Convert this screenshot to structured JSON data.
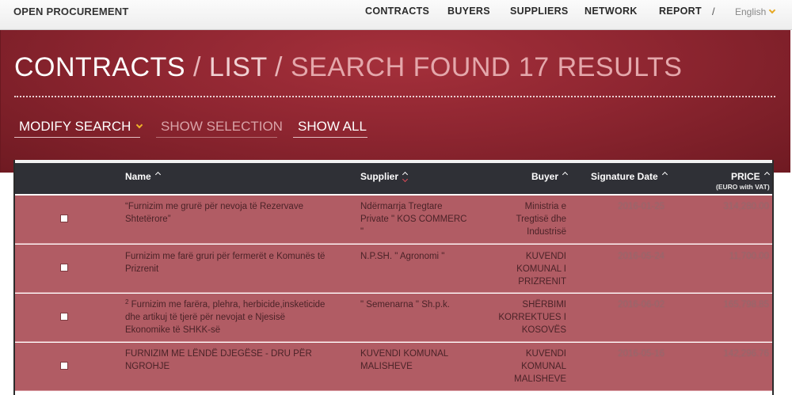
{
  "brand": "OPEN PROCUREMENT",
  "nav": {
    "items": [
      "CONTRACTS",
      "BUYERS",
      "SUPPLIERS",
      "NETWORK",
      "REPORT"
    ],
    "separator": "/",
    "language": "English"
  },
  "hero": {
    "title_main": "CONTRACTS",
    "title_sep": " / ",
    "title_list": "LIST",
    "title_sep2": " / ",
    "title_search": "SEARCH FOUND 17 RESULTS",
    "buttons": {
      "modify": "MODIFY SEARCH",
      "selection": "SHOW SELECTION",
      "all": "SHOW ALL"
    }
  },
  "table": {
    "columns": {
      "name": "Name",
      "supplier": "Supplier",
      "buyer": "Buyer",
      "date": "Signature Date",
      "price": "PRICE",
      "price_sub": "(EURO with VAT)"
    },
    "rows": [
      {
        "name_sup": "",
        "name": "“Furnizim me grurë për nevoja të Rezervave Shtetërore”",
        "supplier": "Ndërmarrja Tregtare Private \" KOS COMMERC \"",
        "buyer": "Ministria e Tregtisë dhe Industrisë",
        "date": "2016-01-25",
        "price": "314,280.00"
      },
      {
        "name_sup": "",
        "name": "Furnizim me farë gruri për fermerët e Komunës të Prizrenit",
        "supplier": "N.P.SH. \" Agronomi \"",
        "buyer": "KUVENDI KOMUNAL I PRIZRENIT",
        "date": "2016-05-24",
        "price": "11,700.00"
      },
      {
        "name_sup": "2",
        "name": " Furnizim me farëra, plehra, herbicide,insketicide dhe artikuj të tjerë për nevojat e Njesisë Ekonomike të SHKK-së",
        "supplier": "\" Semenarna \" Sh.p.k.",
        "buyer": "SHËRBIMI KORREKTUES I KOSOVËS",
        "date": "2016-06-02",
        "price": "165,798.85"
      },
      {
        "name_sup": "",
        "name": "FURNIZIM ME LËNDË DJEGËSE - DRU PËR NGROHJE",
        "supplier": "KUVENDI KOMUNAL MALISHEVE",
        "buyer": "KUVENDI KOMUNAL MALISHEVE",
        "date": "2016-05-16",
        "price": "142,296.76"
      }
    ]
  },
  "colors": {
    "hero": "#8f2631",
    "row": "#b15c64",
    "header": "#2f3036",
    "accent": "#f0b429"
  }
}
